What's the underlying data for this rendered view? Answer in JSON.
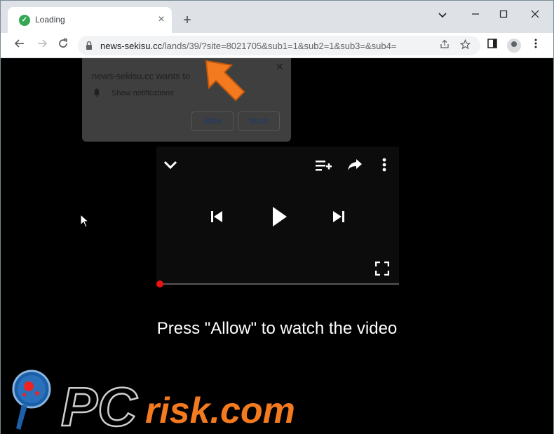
{
  "browser": {
    "tab": {
      "title": "Loading",
      "favicon": "green-shield-icon"
    },
    "new_tab_icon": "plus-icon",
    "window_controls": [
      "chevron-down-icon",
      "minimize-icon",
      "maximize-icon",
      "close-icon"
    ],
    "url": {
      "host": "news-sekisu.cc",
      "rest": "/lands/39/?site=8021705&sub1=1&sub2=1&sub3=&sub4="
    }
  },
  "notification": {
    "title": "news-sekisu.cc wants to",
    "permission": "Show notifications",
    "allow_label": "Allow",
    "block_label": "Block"
  },
  "player": {
    "progress": 0
  },
  "cta_text": "Press \"Allow\" to watch the video",
  "watermark": {
    "text": "PCrisk.com"
  },
  "colors": {
    "accent_orange": "#f47a20",
    "progress_red": "#e11111"
  }
}
